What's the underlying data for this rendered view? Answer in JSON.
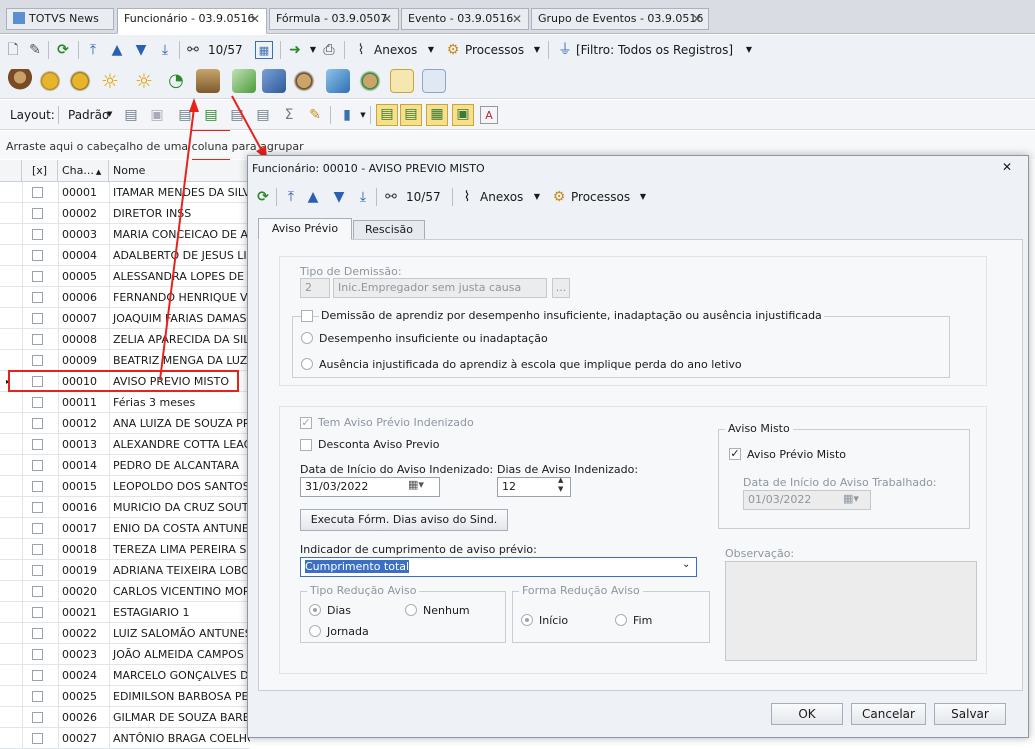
{
  "tabs": [
    {
      "label": "TOTVS News"
    },
    {
      "label": "Funcionário - 03.9.0516"
    },
    {
      "label": "Fórmula - 03.9.0507"
    },
    {
      "label": "Evento - 03.9.0516"
    },
    {
      "label": "Grupo de Eventos - 03.9.0516"
    }
  ],
  "toolbar": {
    "record_counter": "10/57",
    "anexos": "Anexos",
    "processos": "Processos",
    "filter": "[Filtro: Todos os Registros]"
  },
  "layout_bar": {
    "label": "Layout:",
    "value": "Padrão"
  },
  "group_hint": "Arraste aqui o cabeçalho de uma coluna para agrupar",
  "grid": {
    "columns": [
      "[x]",
      "Cha...",
      "Nome"
    ],
    "rows": [
      {
        "code": "00001",
        "name": "ITAMAR MENDES DA SILVEIRA"
      },
      {
        "code": "00002",
        "name": "DIRETOR INSS"
      },
      {
        "code": "00003",
        "name": "MARIA CONCEICAO DE ASSIS"
      },
      {
        "code": "00004",
        "name": "ADALBERTO DE JESUS LIMA"
      },
      {
        "code": "00005",
        "name": "ALESSANDRA LOPES DE ABREU"
      },
      {
        "code": "00006",
        "name": "FERNANDO HENRIQUE VALLE"
      },
      {
        "code": "00007",
        "name": "JOAQUIM FARIAS DAMASCENO"
      },
      {
        "code": "00008",
        "name": "ZELIA APARECIDA DA SILVA"
      },
      {
        "code": "00009",
        "name": "BEATRIZ MENGA DA LUZ"
      },
      {
        "code": "00010",
        "name": "AVISO PREVIO MISTO"
      },
      {
        "code": "00011",
        "name": "Férias 3 meses"
      },
      {
        "code": "00012",
        "name": "ANA LUIZA  DE SOUZA PRADO"
      },
      {
        "code": "00013",
        "name": "ALEXANDRE COTTA LEAO"
      },
      {
        "code": "00014",
        "name": "PEDRO DE ALCANTARA"
      },
      {
        "code": "00015",
        "name": "LEOPOLDO DOS SANTOS DIAS"
      },
      {
        "code": "00016",
        "name": "MURICIO DA CRUZ SOUTO"
      },
      {
        "code": "00017",
        "name": "ENIO DA COSTA ANTUNES"
      },
      {
        "code": "00018",
        "name": "TEREZA LIMA PEREIRA SOARES"
      },
      {
        "code": "00019",
        "name": "ADRIANA TEIXEIRA LOBO"
      },
      {
        "code": "00020",
        "name": "CARLOS VICENTINO MORAES"
      },
      {
        "code": "00021",
        "name": "ESTAGIARIO 1"
      },
      {
        "code": "00022",
        "name": "LUIZ SALOMÃO ANTUNES DIAS"
      },
      {
        "code": "00023",
        "name": "JOÃO ALMEIDA CAMPOS CRUZ"
      },
      {
        "code": "00024",
        "name": "MARCELO GONÇALVES DE ALMEIDA"
      },
      {
        "code": "00025",
        "name": "EDIMILSON BARBOSA PEREIRA"
      },
      {
        "code": "00026",
        "name": "GILMAR DE SOUZA BARBOSA"
      },
      {
        "code": "00027",
        "name": "ANTÔNIO BRAGA COELHO"
      }
    ]
  },
  "dialog": {
    "title": "Funcionário: 00010 - AVISO PREVIO MISTO",
    "record_counter": "10/57",
    "anexos": "Anexos",
    "processos": "Processos",
    "tabs": [
      "Aviso Prévio",
      "Rescisão"
    ],
    "tipo_demissao": {
      "label": "Tipo de Demissão:",
      "code": "2",
      "desc": "Inic.Empregador sem justa causa",
      "lookup": "..."
    },
    "aprendiz_check": "Demissão de aprendiz por desempenho insuficiente, inadaptação ou ausência injustificada",
    "aprendiz_opt1": "Desempenho insuficiente ou inadaptação",
    "aprendiz_opt2": "Ausência injustificada do aprendiz à escola que implique perda do ano letivo",
    "tem_aviso": "Tem Aviso Prévio Indenizado",
    "desconta": "Desconta Aviso Previo",
    "data_inicio_label": "Data de Início do Aviso Indenizado:",
    "data_inicio_value": "31/03/2022",
    "dias_label": "Dias de Aviso Indenizado:",
    "dias_value": "12",
    "executa_button": "Executa Fórm. Dias aviso do Sind.",
    "aviso_misto": {
      "title": "Aviso Misto",
      "check_label": "Aviso Prévio Misto",
      "data_label": "Data de Início do Aviso Trabalhado:",
      "data_value": "01/03/2022"
    },
    "indicador_label": "Indicador de cumprimento de aviso prévio:",
    "indicador_value": "Cumprimento total",
    "observacao_label": "Observação:",
    "tipo_reducao": {
      "title": "Tipo Redução Aviso",
      "opt_dias": "Dias",
      "opt_nenhum": "Nenhum",
      "opt_jornada": "Jornada"
    },
    "forma_reducao": {
      "title": "Forma Redução Aviso",
      "opt_inicio": "Início",
      "opt_fim": "Fim"
    },
    "buttons": {
      "ok": "OK",
      "cancel": "Cancelar",
      "save": "Salvar"
    }
  },
  "colors": {
    "highlight": "#e8221b",
    "selection": "#3b6fc4"
  }
}
